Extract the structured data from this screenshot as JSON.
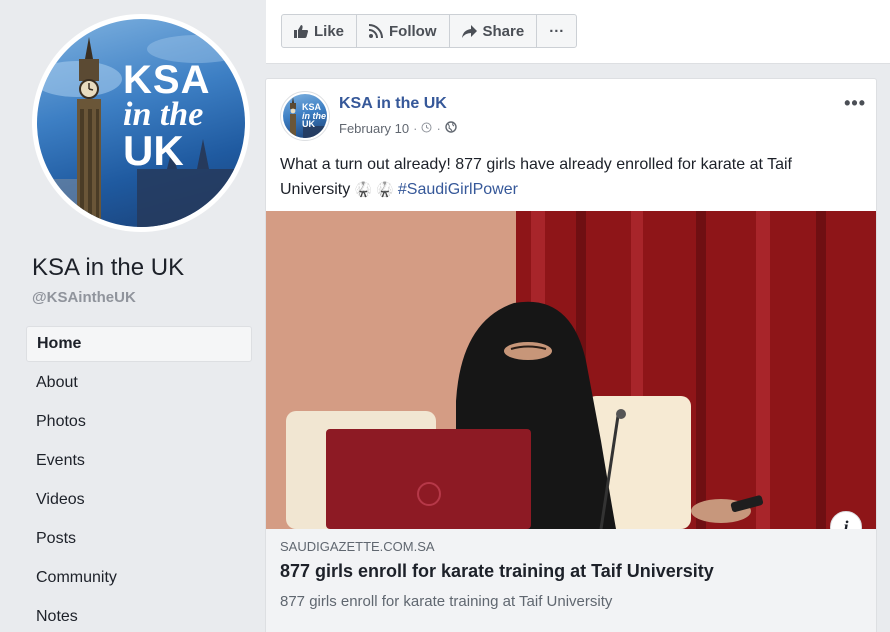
{
  "page": {
    "name": "KSA in the UK",
    "handle": "@KSAintheUK",
    "profile_pic_text": [
      "KSA",
      "in the",
      "UK"
    ]
  },
  "nav": {
    "items": [
      {
        "label": "Home",
        "active": true
      },
      {
        "label": "About"
      },
      {
        "label": "Photos"
      },
      {
        "label": "Events"
      },
      {
        "label": "Videos"
      },
      {
        "label": "Posts"
      },
      {
        "label": "Community"
      },
      {
        "label": "Notes"
      }
    ]
  },
  "actions": {
    "like_label": "Like",
    "follow_label": "Follow",
    "share_label": "Share",
    "more_label": "···"
  },
  "post": {
    "author": "KSA in the UK",
    "date": "February 10",
    "text_part1": "What a turn out already! 877 girls have already enrolled for karate at Taif University",
    "emoji": "🥋 🥋",
    "hashtag": "#SaudiGirlPower",
    "menu_label": "•••",
    "info_label": "i",
    "link": {
      "domain": "SAUDIGAZETTE.COM.SA",
      "title": "877 girls enroll for karate training at Taif University",
      "description": "877 girls enroll for karate training at Taif University"
    }
  },
  "colors": {
    "link_blue": "#365899",
    "background": "#e9ebee",
    "curtain_red": "#8e1518"
  },
  "icons": [
    "thumbs-up-icon",
    "rss-icon",
    "share-arrow-icon",
    "more-dots-icon",
    "globe-icon",
    "clock-icon",
    "info-icon"
  ]
}
